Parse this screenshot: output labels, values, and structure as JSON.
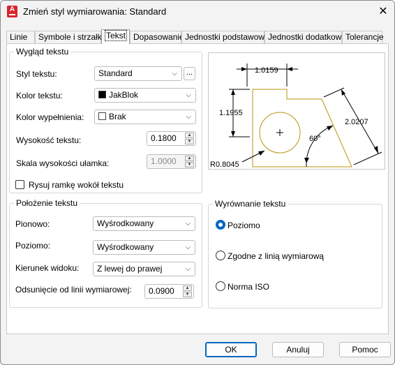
{
  "window": {
    "title": "Zmień styl wymiarowania: Standard"
  },
  "tabs": [
    {
      "label": "Linie"
    },
    {
      "label": "Symbole i strzałki"
    },
    {
      "label": "Tekst"
    },
    {
      "label": "Dopasowanie"
    },
    {
      "label": "Jednostki podstawowe"
    },
    {
      "label": "Jednostki dodatkowe"
    },
    {
      "label": "Tolerancje"
    }
  ],
  "appearance": {
    "group_title": "Wygląd tekstu",
    "style_label": "Styl tekstu:",
    "style_value": "Standard",
    "browse_label": "...",
    "color_label": "Kolor tekstu:",
    "color_value": "JakBlok",
    "color_swatch": "#000000",
    "fill_label": "Kolor wypełnienia:",
    "fill_value": "Brak",
    "fill_swatch": "#ffffff",
    "height_label": "Wysokość tekstu:",
    "height_value": "0.1800",
    "fraction_label": "Skala wysokości ułamka:",
    "fraction_value": "1.0000",
    "frame_label": "Rysuj ramkę wokół tekstu"
  },
  "placement": {
    "group_title": "Położenie tekstu",
    "vertical_label": "Pionowo:",
    "vertical_value": "Wyśrodkowany",
    "horizontal_label": "Poziomo:",
    "horizontal_value": "Wyśrodkowany",
    "direction_label": "Kierunek widoku:",
    "direction_value": "Z lewej do prawej",
    "offset_label": "Odsunięcie od linii wymiarowej:",
    "offset_value": "0.0900"
  },
  "alignment": {
    "group_title": "Wyrównanie tekstu",
    "options": [
      {
        "label": "Poziomo",
        "checked": true
      },
      {
        "label": "Zgodne z linią wymiarową",
        "checked": false
      },
      {
        "label": "Norma ISO",
        "checked": false
      }
    ]
  },
  "preview": {
    "dim_top": "1.0159",
    "dim_left": "1.1955",
    "dim_right": "2.0207",
    "dim_angle": "60°",
    "dim_radius": "R0.8045",
    "geometry_color": "#b8960c"
  },
  "buttons": {
    "ok": "OK",
    "cancel": "Anuluj",
    "help": "Pomoc"
  }
}
